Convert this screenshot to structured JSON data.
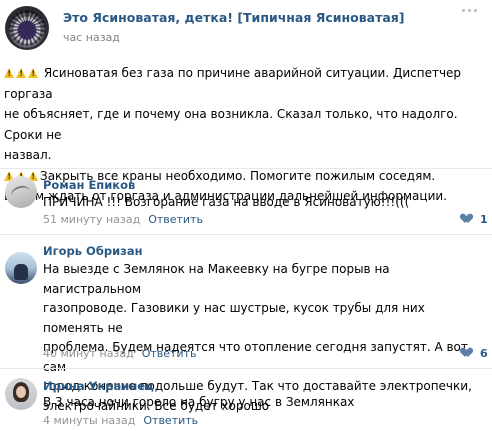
{
  "post": {
    "author": "Это Ясиноватая, детка! [Типичная Ясиноватая]",
    "time": "час назад",
    "avatar_icon": "community-avatar",
    "body_lines": [
      "Ясиноватая без газа по причине аварийной ситуации. Диспетчер горгаза",
      "не объясняет, где и почему она возникла. Сказал только, что надолго. Сроки не",
      "назвал.",
      "Закрыть все краны необходимо. Помогите пожилым соседям.",
      "Будем ждать от горгаза и администрации дальнейшей информации."
    ],
    "warning_icon": "warning-sign-icon"
  },
  "comments": [
    {
      "name": "Роман Епиков",
      "lines": [
        "ПРИЧИНА !!! Возгорание газа на вводе в Ясиноватую!!!((("
      ],
      "time": "51 минуту назад",
      "reply": "Ответить",
      "likes": "1"
    },
    {
      "name": "Игорь Обризан",
      "lines": [
        "На выезде с Землянок на Макеевку на бугре порыв на магистральном",
        "газопроводе. Газовики у нас шустрые, кусок трубы для них поменять не",
        "проблема. Будем надеятся что отопление сегодня запустят. А вот сам",
        "город конечно подольше будут. Так что доставайте электропечки,",
        "электрочайники. Все будет хорошо"
      ],
      "time": "40 минут назад",
      "reply": "Ответить",
      "likes": "6"
    },
    {
      "name": "Ирина Украинец",
      "lines": [
        "В 3 часа ночи горело на бугру у нас в Землянках"
      ],
      "time": "4 минуты назад",
      "reply": "Ответить",
      "likes": ""
    }
  ],
  "colors": {
    "link": "#2a5885",
    "meta": "#939393",
    "warning": "#f3c022",
    "divider": "#e7e8ec"
  }
}
